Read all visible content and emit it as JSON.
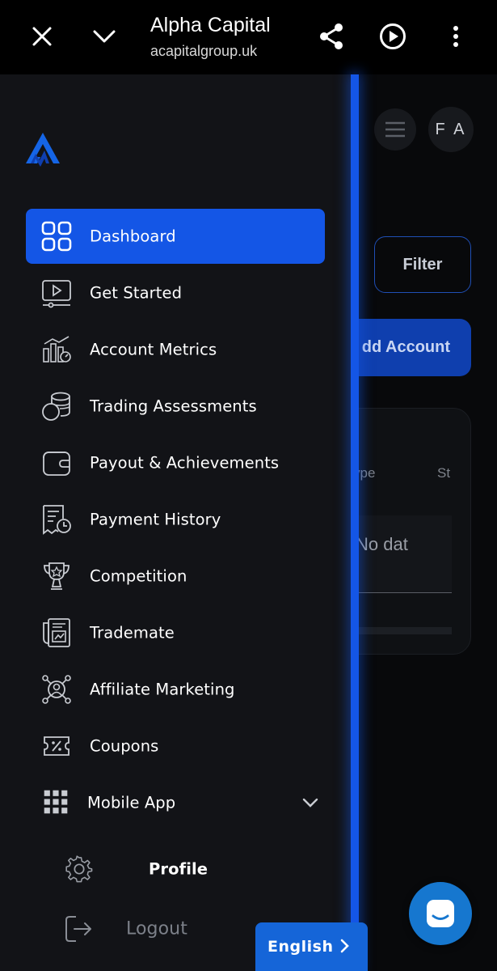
{
  "browser": {
    "title": "Alpha Capital",
    "url": "acapitalgroup.uk"
  },
  "colors": {
    "accent": "#1456e6",
    "drawer_bg": "#121317",
    "topbar_bg": "#000000",
    "language_button": "#1565d8",
    "chat_button": "#1677cf"
  },
  "drawer": {
    "items": [
      {
        "label": "Dashboard",
        "icon": "grid-icon",
        "active": true
      },
      {
        "label": "Get Started",
        "icon": "video-icon",
        "active": false
      },
      {
        "label": "Account Metrics",
        "icon": "chart-icon",
        "active": false
      },
      {
        "label": "Trading Assessments",
        "icon": "coins-icon",
        "active": false
      },
      {
        "label": "Payout & Achievements",
        "icon": "wallet-icon",
        "active": false
      },
      {
        "label": "Payment History",
        "icon": "receipt-clock-icon",
        "active": false
      },
      {
        "label": "Competition",
        "icon": "trophy-icon",
        "active": false
      },
      {
        "label": "Trademate",
        "icon": "document-chart-icon",
        "active": false
      },
      {
        "label": "Affiliate Marketing",
        "icon": "network-user-icon",
        "active": false
      },
      {
        "label": "Coupons",
        "icon": "coupon-icon",
        "active": false
      }
    ],
    "mobile_app": {
      "label": "Mobile App",
      "icon": "apps-grid-icon"
    },
    "profile": {
      "label": "Profile",
      "icon": "gear-icon"
    },
    "logout": {
      "label": "Logout",
      "icon": "logout-icon"
    }
  },
  "background_page": {
    "avatar_initials": "F A",
    "filter_label": "Filter",
    "add_account_label": "dd Account",
    "table_headers": [
      "ype",
      "St"
    ],
    "empty_text": "No dat"
  },
  "language": {
    "label": "English"
  }
}
